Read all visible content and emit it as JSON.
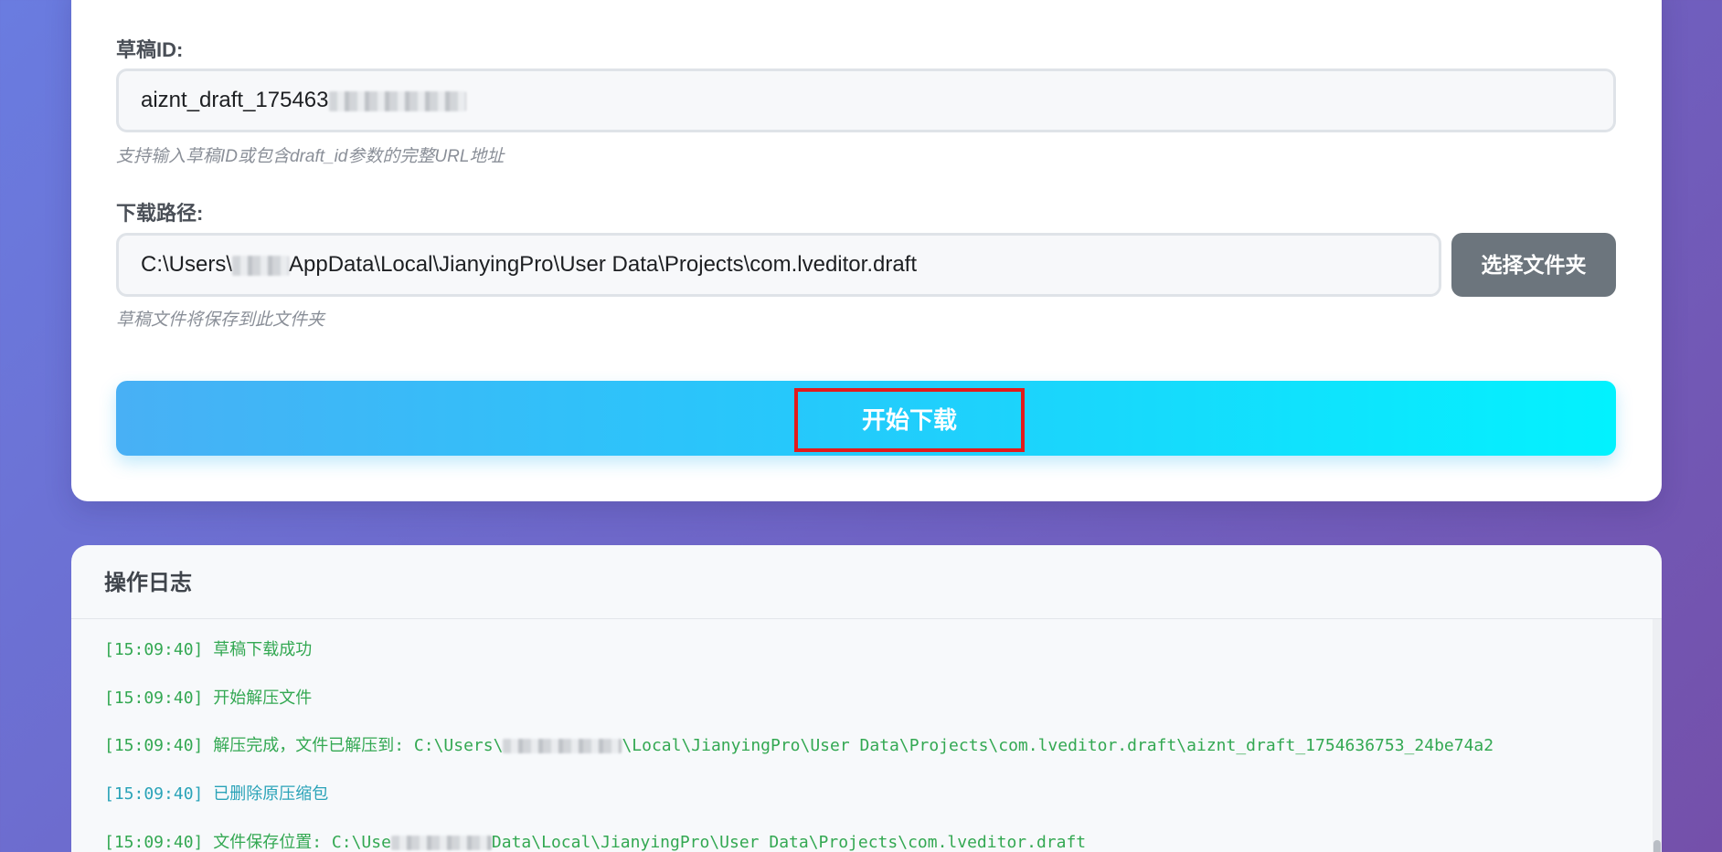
{
  "form": {
    "draft_id_label": "草稿ID:",
    "draft_id_value_visible": "aiznt_draft_175463",
    "draft_id_value_tail": "",
    "draft_id_hint": "支持输入草稿ID或包含draft_id参数的完整URL地址",
    "path_label": "下载路径:",
    "path_value_prefix": "C:\\Users\\",
    "path_value_suffix": "AppData\\Local\\JianyingPro\\User Data\\Projects\\com.lveditor.draft",
    "path_hint": "草稿文件将保存到此文件夹",
    "choose_folder_label": "选择文件夹",
    "start_label": "开始下载"
  },
  "log": {
    "title": "操作日志",
    "entries": [
      {
        "time": "[15:09:40]",
        "text": "草稿下载成功",
        "level": "success"
      },
      {
        "time": "[15:09:40]",
        "text": "开始解压文件",
        "level": "success"
      },
      {
        "time": "[15:09:40]",
        "text_prefix": "解压完成，文件已解压到: C:\\Users\\",
        "text_suffix": "\\Local\\JianyingPro\\User Data\\Projects\\com.lveditor.draft\\aiznt_draft_1754636753_24be74a2",
        "level": "success"
      },
      {
        "time": "[15:09:40]",
        "text": "已删除原压缩包",
        "level": "info"
      },
      {
        "time": "[15:09:40]",
        "text_prefix": "文件保存位置: C:\\Use",
        "text_suffix": "Data\\Local\\JianyingPro\\User Data\\Projects\\com.lveditor.draft",
        "level": "success"
      }
    ]
  },
  "colors": {
    "success": "#33a852",
    "info": "#2aa3b8",
    "button_gray": "#6c757d",
    "highlight": "#e21b1b"
  }
}
